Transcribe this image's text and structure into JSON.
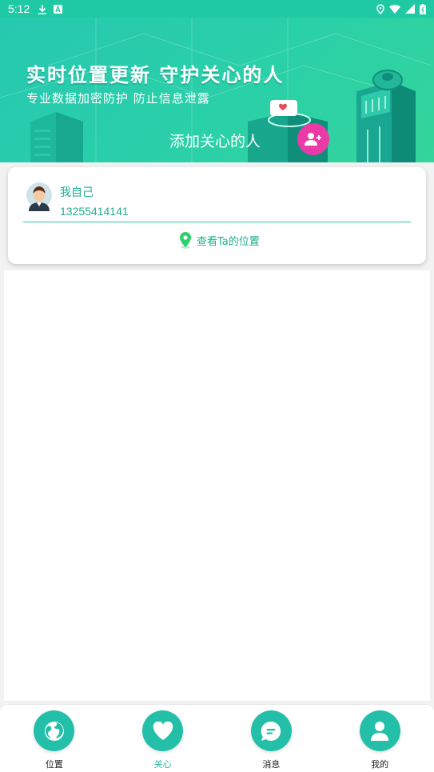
{
  "status_bar": {
    "time": "5:12"
  },
  "banner": {
    "headline": "实时位置更新 守护关心的人",
    "subline": "专业数据加密防护 防止信息泄露",
    "add_label": "添加关心的人"
  },
  "contact": {
    "name": "我自己",
    "phone": "13255414141",
    "view_location": "查看Ta的位置"
  },
  "tabs": [
    {
      "label": "位置",
      "icon": "globe-icon"
    },
    {
      "label": "关心",
      "icon": "heart-icon"
    },
    {
      "label": "消息",
      "icon": "chat-icon"
    },
    {
      "label": "我的",
      "icon": "person-icon"
    }
  ],
  "colors": {
    "accent": "#23bfa9",
    "add_button": "#e93aa7"
  }
}
